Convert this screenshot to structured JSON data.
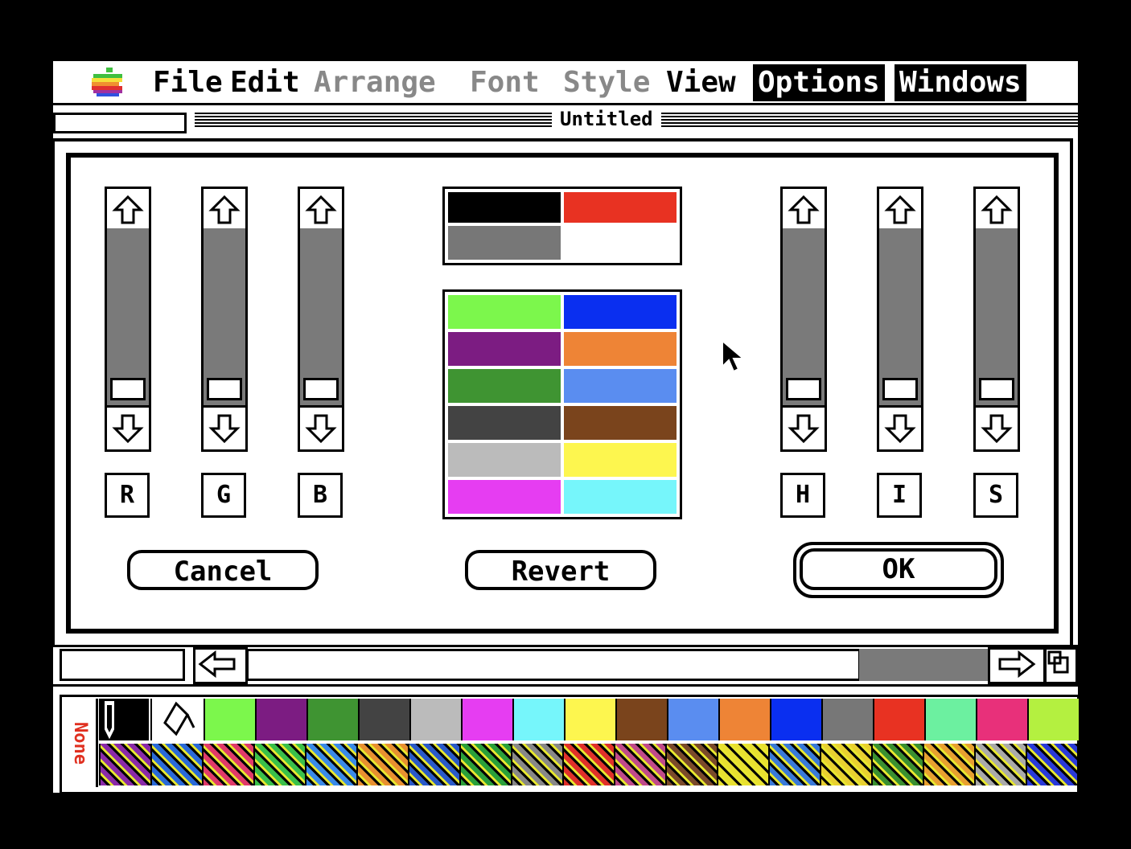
{
  "menubar": {
    "apple": "apple-logo",
    "items": [
      {
        "label": "File",
        "state": "normal"
      },
      {
        "label": "Edit",
        "state": "normal"
      },
      {
        "label": "Arrange",
        "state": "disabled"
      },
      {
        "label": "Font",
        "state": "disabled"
      },
      {
        "label": "Style",
        "state": "disabled"
      },
      {
        "label": "View",
        "state": "normal"
      },
      {
        "label": "Options",
        "state": "active"
      },
      {
        "label": "Windows",
        "state": "active"
      }
    ]
  },
  "window": {
    "title": "Untitled"
  },
  "dialog": {
    "sliders_left": [
      "R",
      "G",
      "B"
    ],
    "sliders_right": [
      "H",
      "I",
      "S"
    ],
    "slider_levels": {
      "R": 0,
      "G": 0,
      "B": 0,
      "H": 0,
      "I": 0,
      "S": 0
    },
    "current_swatches": [
      "#000000",
      "#e83222",
      "#777777",
      "#ffffff"
    ],
    "palette_swatches": [
      [
        "#7cf74c",
        "#0a2ff0"
      ],
      [
        "#7c1c82",
        "#ee8436"
      ],
      [
        "#3f9432",
        "#5a8df0"
      ],
      [
        "#434343",
        "#7a441c"
      ],
      [
        "#bbbbbb",
        "#fdf64f"
      ],
      [
        "#e63df2",
        "#76f6fb"
      ]
    ],
    "buttons": {
      "cancel": "Cancel",
      "revert": "Revert",
      "ok": "OK"
    }
  },
  "palette_bar": {
    "none_label": "None",
    "colors": [
      "#7cf74c",
      "#7c1c82",
      "#3f9432",
      "#434343",
      "#bbbbbb",
      "#e63df2",
      "#76f6fb",
      "#fdf64f",
      "#7a441c",
      "#5a8df0",
      "#ee8436",
      "#0a2ff0",
      "#777777",
      "#e83222",
      "#6cf0a0",
      "#e8307a",
      "#b4f040"
    ],
    "patterns": [
      "#8a2aa8",
      "#2a6ad8",
      "#e03a6a",
      "#3ac04a",
      "#3a8ae8",
      "#e89030",
      "#2a5ac8",
      "#2aa03a",
      "#888888",
      "#e0302a",
      "#c04a8a",
      "#7a4a2a",
      "#e8e030",
      "#3a7ad8",
      "#e8d030",
      "#3a9030",
      "#e8a030",
      "#aaaaaa",
      "#2a3ad8"
    ]
  },
  "colors": {
    "accent": "#000000",
    "track": "#7a7a7a"
  }
}
